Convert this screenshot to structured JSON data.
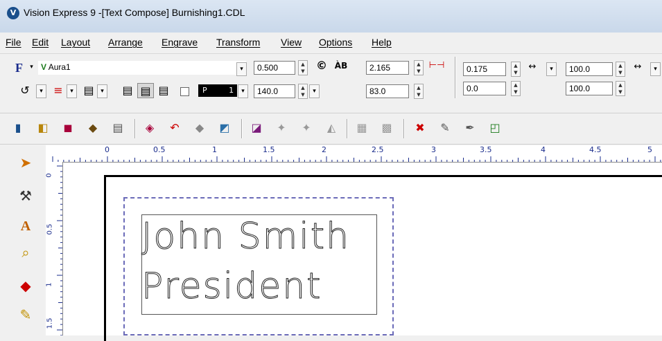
{
  "window": {
    "title": "Vision Express 9 -[Text Compose] Burnishing1.CDL"
  },
  "menu": [
    "File",
    "Edit",
    "Layout",
    "Arrange",
    "Engrave",
    "Transform",
    "View",
    "Options",
    "Help"
  ],
  "format_bar": {
    "font_button": "F",
    "font_name": "Aura1",
    "font_prefix": "V",
    "height": "0.500",
    "copyright_glyph": "©",
    "ab_glyph": "ÀB",
    "width_value": "2.165",
    "angle": "140.0",
    "color_label": "P",
    "color_num": "1",
    "value_83": "83.0",
    "pos_x": "0.175",
    "pos_y": "0.0",
    "scale_x": "100.0",
    "scale_y": "100.0"
  },
  "ruler": {
    "labels": [
      "0",
      "0.5",
      "1",
      "1.5",
      "2",
      "2.5",
      "3",
      "3.5",
      "4",
      "4.5",
      "5"
    ],
    "vlabels": [
      "0",
      "0.5",
      "1",
      "1.5"
    ]
  },
  "document": {
    "line1": "John Smith",
    "line2": "President"
  },
  "colors": {
    "selection": "#6a6ab8",
    "canvas_border": "#000000",
    "accent": "#1a4f8c"
  }
}
